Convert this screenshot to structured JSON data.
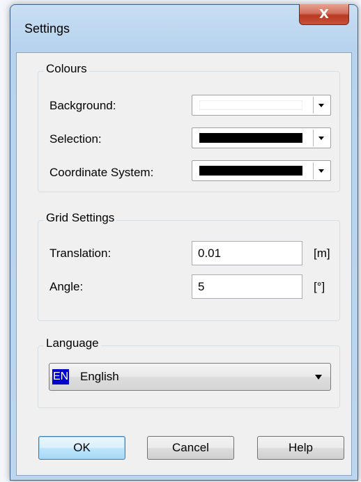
{
  "window": {
    "title": "Settings",
    "close_label": "X"
  },
  "colours": {
    "legend": "Colours",
    "rows": [
      {
        "label": "Background:",
        "swatch_color": "#ffffff"
      },
      {
        "label": "Selection:",
        "swatch_color": "#000000"
      },
      {
        "label": "Coordinate System:",
        "swatch_color": "#000000"
      }
    ]
  },
  "grid": {
    "legend": "Grid Settings",
    "translation_label": "Translation:",
    "translation_value": "0.01",
    "translation_unit": "[m]",
    "angle_label": "Angle:",
    "angle_value": "5",
    "angle_unit": "[°]"
  },
  "language": {
    "legend": "Language",
    "flag_text": "EN",
    "selected": "English"
  },
  "buttons": {
    "ok": "OK",
    "cancel": "Cancel",
    "help": "Help"
  }
}
